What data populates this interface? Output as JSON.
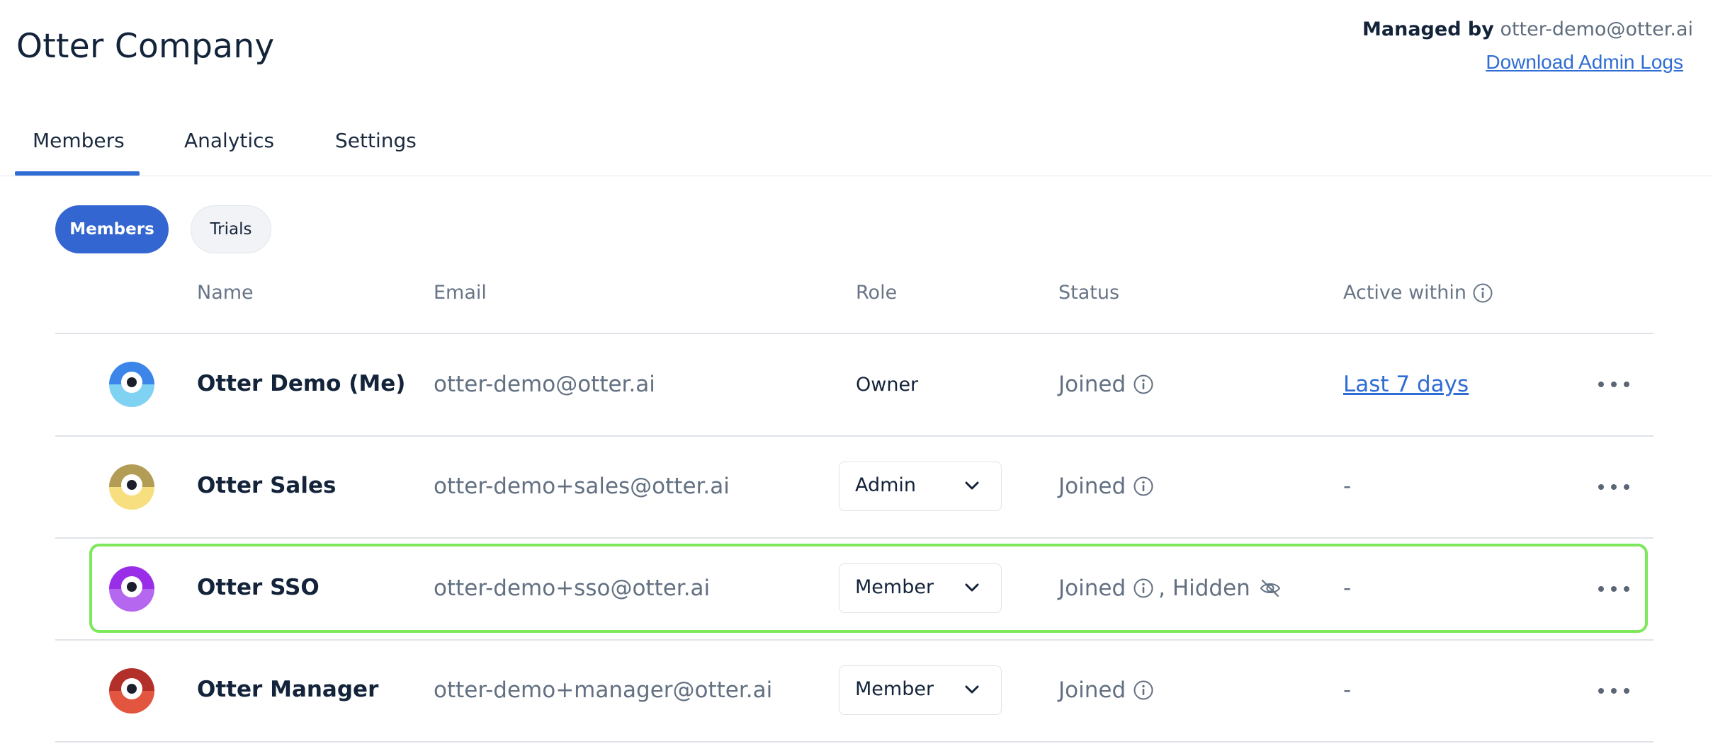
{
  "header": {
    "company": "Otter Company",
    "managed_label": "Managed by",
    "managed_email": "otter-demo@otter.ai",
    "download_logs": "Download Admin Logs"
  },
  "tabs": [
    {
      "label": "Members",
      "active": true
    },
    {
      "label": "Analytics",
      "active": false
    },
    {
      "label": "Settings",
      "active": false
    }
  ],
  "filters": [
    {
      "label": "Members",
      "active": true
    },
    {
      "label": "Trials",
      "active": false
    }
  ],
  "table": {
    "columns": {
      "name": "Name",
      "email": "Email",
      "role": "Role",
      "status": "Status",
      "active": "Active within"
    },
    "rows": [
      {
        "name": "Otter Demo (Me)",
        "email": "otter-demo@otter.ai",
        "role": "Owner",
        "role_editable": false,
        "status": "Joined",
        "hidden": "",
        "active": "Last 7 days",
        "avatar_top": "#3b86e8",
        "avatar_bottom": "#7fd2f2"
      },
      {
        "name": "Otter Sales",
        "email": "otter-demo+sales@otter.ai",
        "role": "Admin",
        "role_editable": true,
        "status": "Joined",
        "hidden": "",
        "active": "-",
        "avatar_top": "#b39c55",
        "avatar_bottom": "#f7df80"
      },
      {
        "name": "Otter SSO",
        "email": "otter-demo+sso@otter.ai",
        "role": "Member",
        "role_editable": true,
        "status": "Joined",
        "hidden": ", Hidden",
        "active": "-",
        "avatar_top": "#9a2ee8",
        "avatar_bottom": "#b567f0"
      },
      {
        "name": "Otter Manager",
        "email": "otter-demo+manager@otter.ai",
        "role": "Member",
        "role_editable": true,
        "status": "Joined",
        "hidden": "",
        "active": "-",
        "avatar_top": "#b3302a",
        "avatar_bottom": "#e2553f"
      }
    ]
  },
  "highlight_color": "#7ee85c",
  "accent_color": "#3366d0"
}
